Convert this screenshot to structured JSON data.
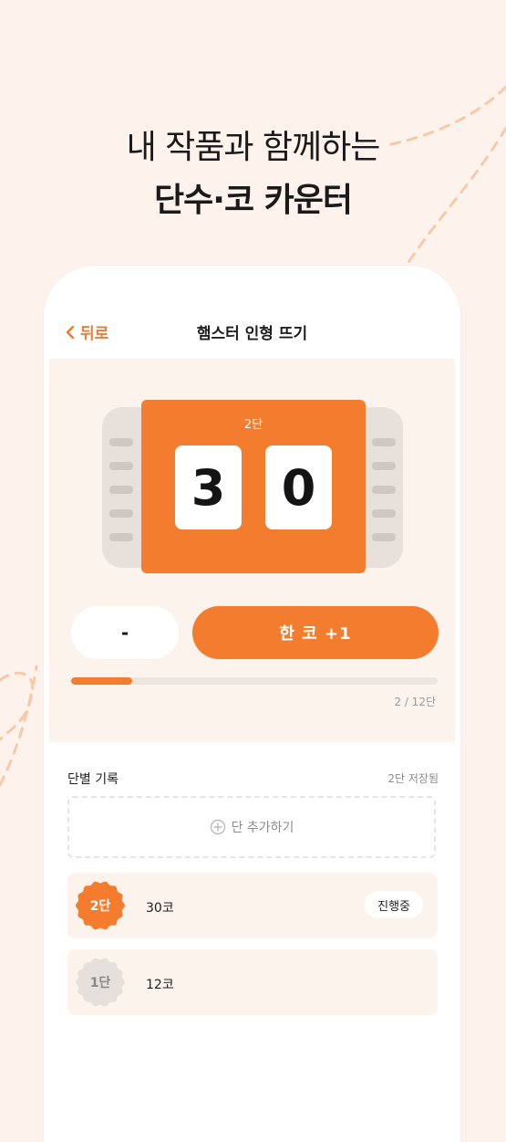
{
  "headline": {
    "line1": "내 작품과 함께하는",
    "line2": "단수·코 카운터"
  },
  "nav": {
    "back_label": "뒤로",
    "title": "햄스터 인형 뜨기"
  },
  "counter": {
    "row_label": "2단",
    "digit_tens": "3",
    "digit_ones": "0",
    "minus_label": "-",
    "plus_label": "한 코 +1",
    "progress_fraction": 0.1667,
    "progress_text": "2 / 12단"
  },
  "rows_section": {
    "title": "단별 기록",
    "saved_note": "2단 저장됨",
    "add_label": "단 추가하기",
    "rows": [
      {
        "badge": "2단",
        "count": "30코",
        "status": "진행중",
        "active": true
      },
      {
        "badge": "1단",
        "count": "12코",
        "status": "",
        "active": false
      }
    ]
  },
  "colors": {
    "accent": "#f47c2f",
    "background": "#fdf3ec",
    "inactive_badge": "#e6e0dc"
  }
}
